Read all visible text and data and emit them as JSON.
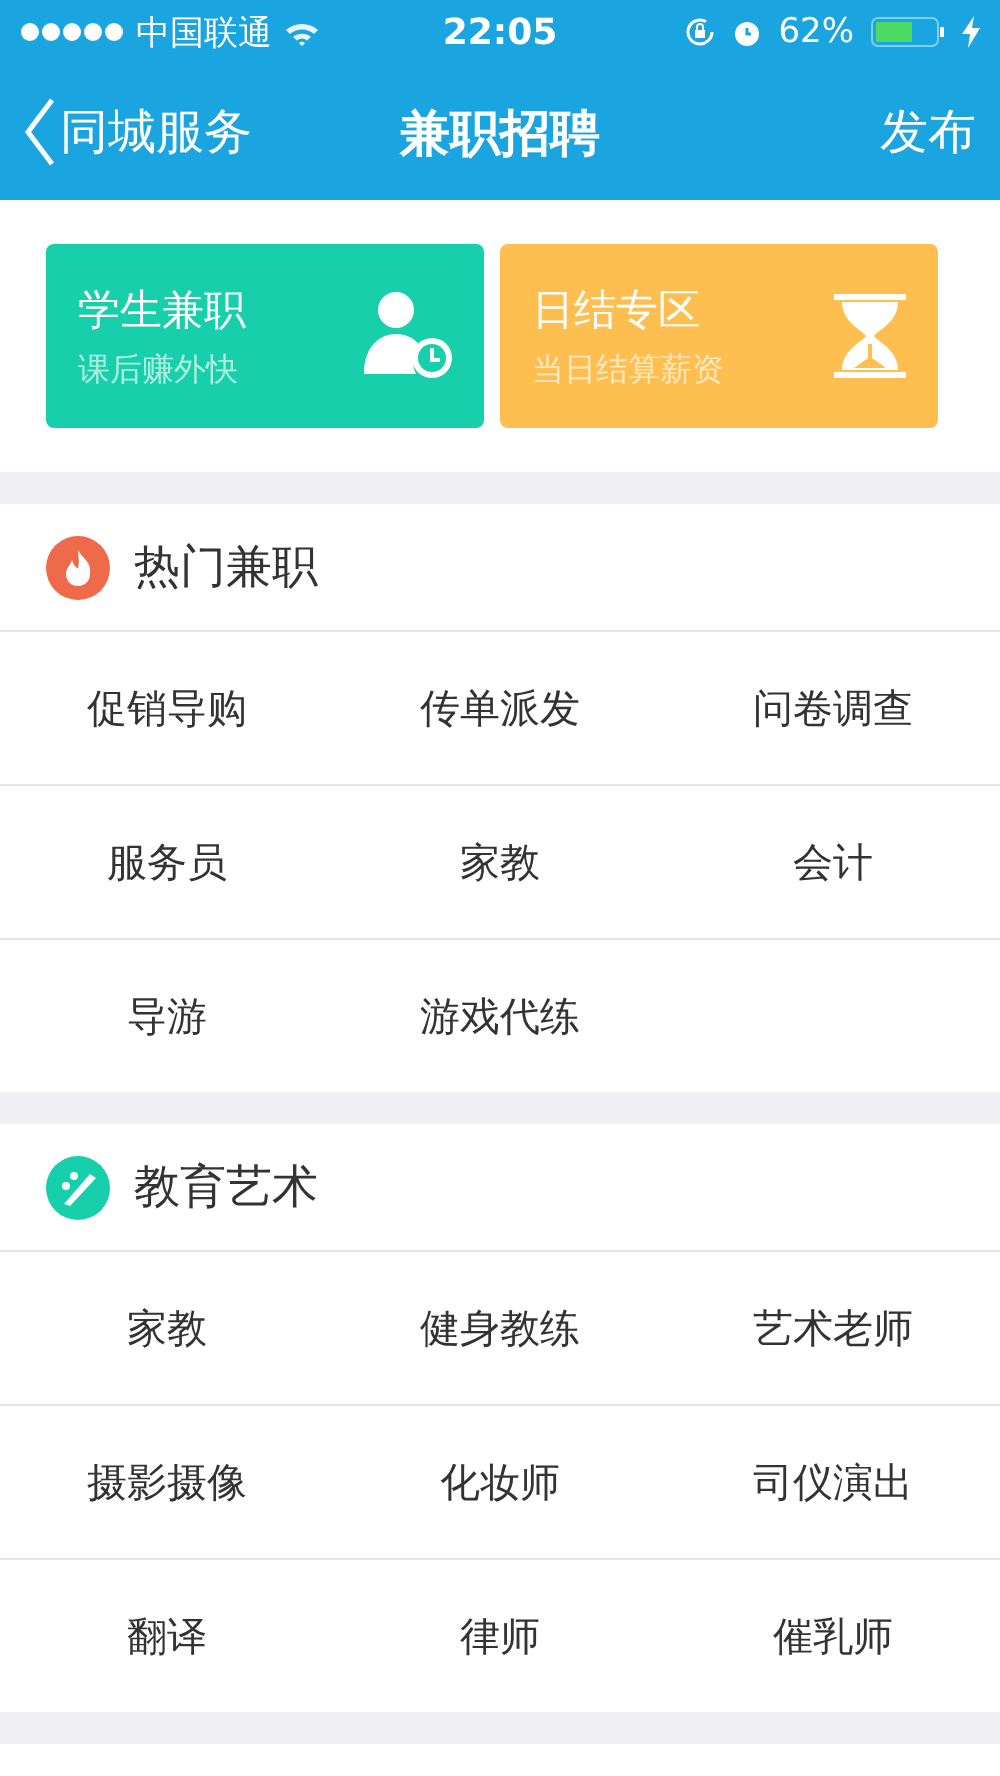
{
  "status_bar": {
    "carrier": "中国联通",
    "time": "22:05",
    "battery": "62%"
  },
  "nav": {
    "back": "同城服务",
    "title": "兼职招聘",
    "action": "发布"
  },
  "cards": [
    {
      "kind": "student",
      "title": "学生兼职",
      "subtitle": "课后赚外快",
      "color": "#17cfab"
    },
    {
      "kind": "daily",
      "title": "日结专区",
      "subtitle": "当日结算薪资",
      "color": "#ffbf50"
    }
  ],
  "sections": [
    {
      "kind": "hot",
      "title": "热门兼职",
      "color": "#ee6a4a",
      "items": [
        "促销导购",
        "传单派发",
        "问卷调查",
        "服务员",
        "家教",
        "会计",
        "导游",
        "游戏代练"
      ]
    },
    {
      "kind": "art",
      "title": "教育艺术",
      "color": "#17cfab",
      "items": [
        "家教",
        "健身教练",
        "艺术老师",
        "摄影摄像",
        "化妆师",
        "司仪演出",
        "翻译",
        "律师",
        "催乳师"
      ]
    }
  ]
}
